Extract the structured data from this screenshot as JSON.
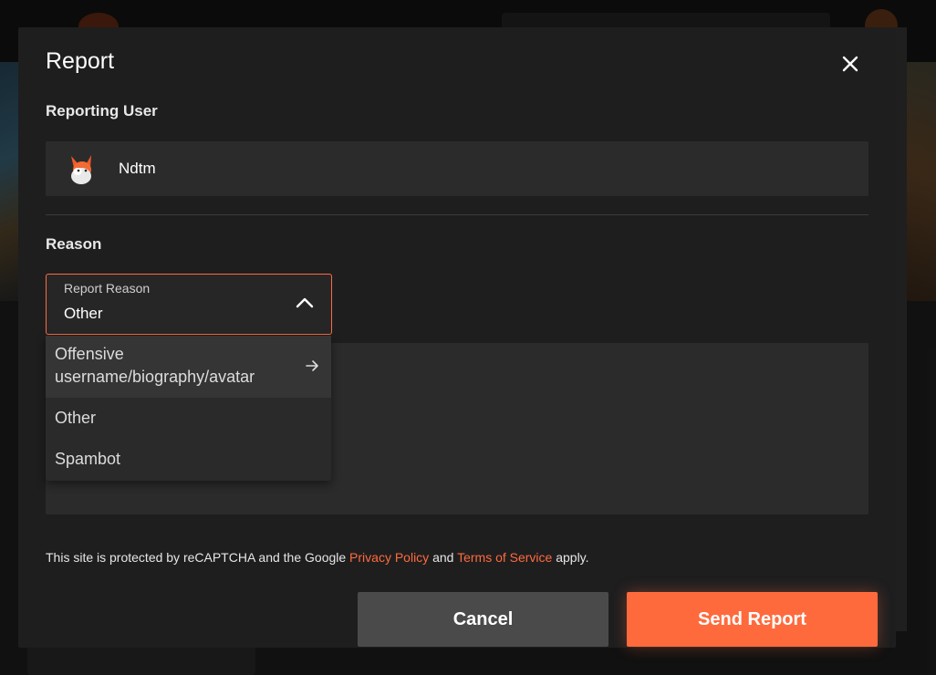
{
  "modal": {
    "title": "Report",
    "close_icon": "close-icon"
  },
  "reporting_user": {
    "section_label": "Reporting User",
    "name": "Ndtm",
    "avatar_icon": "fox-avatar-icon"
  },
  "reason": {
    "section_label": "Reason",
    "select_label": "Report Reason",
    "selected_value": "Other",
    "expanded": true,
    "options": [
      {
        "label_line1": "Offensive",
        "label_line2": "username/biography/avatar",
        "has_arrow": true,
        "hovered": true
      },
      {
        "label": "Other"
      },
      {
        "label": "Spambot"
      }
    ]
  },
  "recaptcha": {
    "prefix": "This site is protected by reCAPTCHA and the Google ",
    "privacy_link": "Privacy Policy",
    "middle": " and ",
    "terms_link": "Terms of Service",
    "suffix": " apply."
  },
  "actions": {
    "cancel_label": "Cancel",
    "send_label": "Send Report"
  },
  "colors": {
    "accent": "#ff6a3d",
    "modal_bg": "#1e1e1f",
    "field_bg": "#2b2b2c",
    "cancel_bg": "#4a4a4b"
  }
}
